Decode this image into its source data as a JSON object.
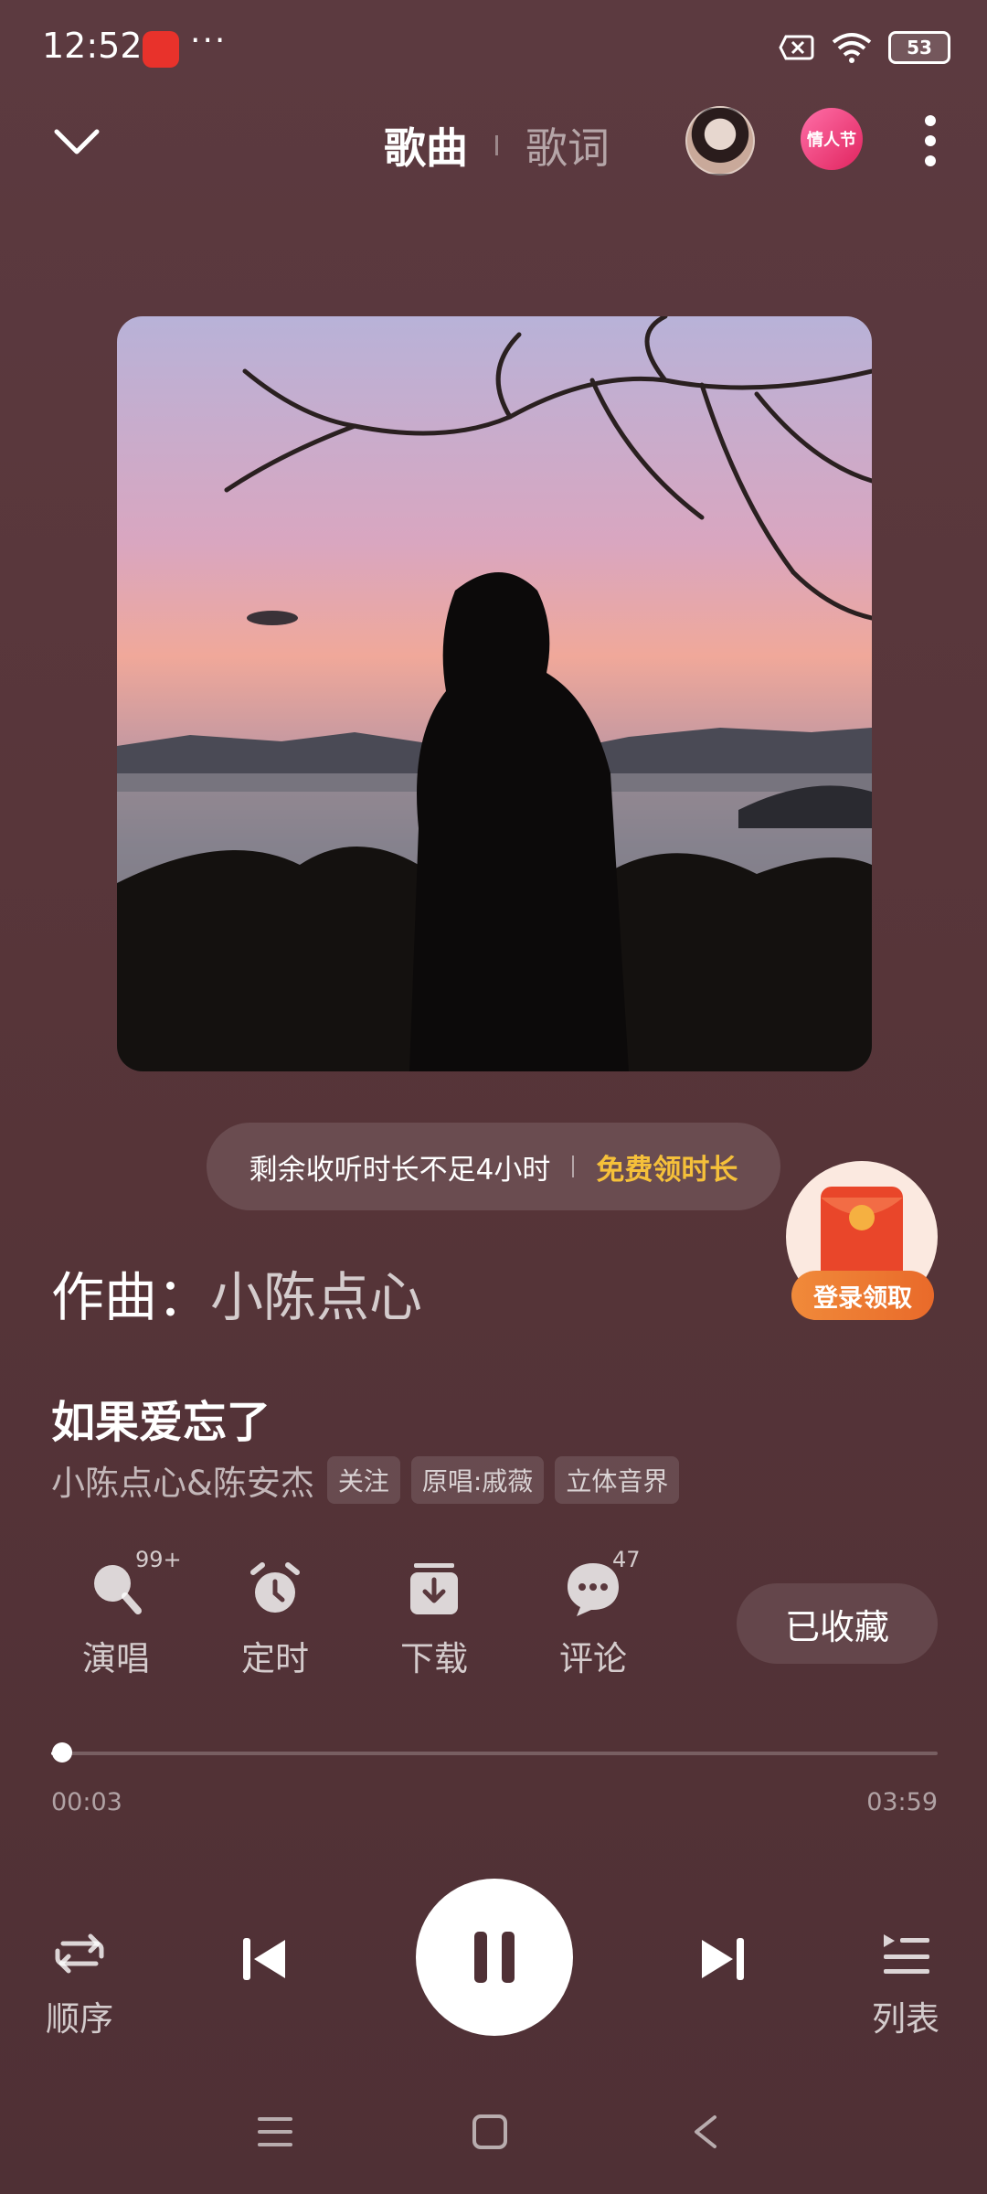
{
  "status_bar": {
    "time": "12:52",
    "more": "···",
    "battery": "53"
  },
  "header": {
    "tab_song": "歌曲",
    "tab_lyrics": "歌词",
    "event_badge": "情人节"
  },
  "promo": {
    "text": "剩余收听时长不足4小时",
    "link": "免费领时长"
  },
  "red_packet": {
    "label": "登录领取"
  },
  "composer": {
    "label": "作曲：",
    "name": "小陈点心"
  },
  "song": {
    "title": "如果爱忘了",
    "artist": "小陈点心&陈安杰",
    "tags": [
      "关注",
      "原唱:戚薇",
      "立体音界"
    ]
  },
  "actions": [
    {
      "label": "演唱",
      "count": "99+",
      "icon": "sing-mic-icon"
    },
    {
      "label": "定时",
      "count": "",
      "icon": "alarm-clock-icon"
    },
    {
      "label": "下载",
      "count": "",
      "icon": "download-icon"
    },
    {
      "label": "评论",
      "count": "47",
      "icon": "comment-icon"
    }
  ],
  "collect_button": "已收藏",
  "playback": {
    "current": "00:03",
    "total": "03:59",
    "progress": 0.0125
  },
  "controls": {
    "mode_label": "顺序",
    "list_label": "列表"
  }
}
